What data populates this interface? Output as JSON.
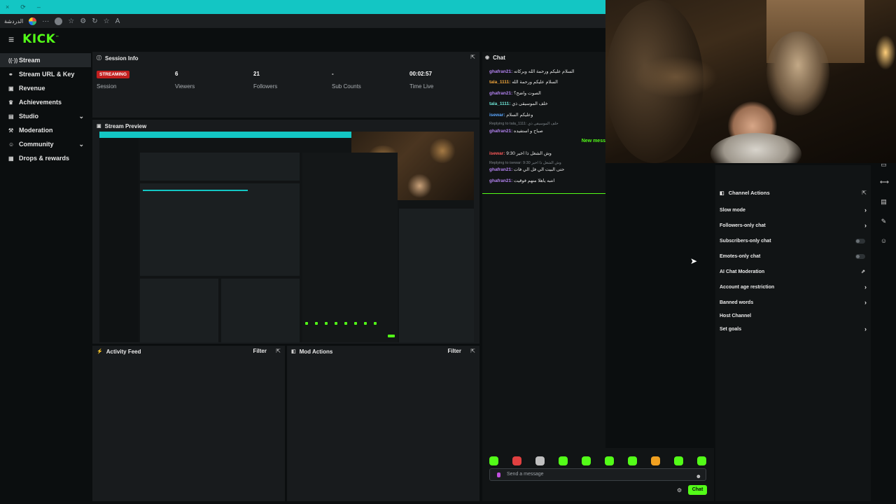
{
  "browser": {
    "tab_label": "الدردشة",
    "controls": [
      "×",
      "⟳",
      "–"
    ]
  },
  "header": {
    "logo": "KICK",
    "logo_tm": "™"
  },
  "sidebar": {
    "items": [
      {
        "label": "Stream",
        "icon": "broadcast-icon"
      },
      {
        "label": "Stream URL & Key",
        "icon": "link-icon"
      },
      {
        "label": "Revenue",
        "icon": "wallet-icon"
      },
      {
        "label": "Achievements",
        "icon": "trophy-icon"
      },
      {
        "label": "Studio",
        "icon": "studio-icon"
      },
      {
        "label": "Moderation",
        "icon": "hammer-icon"
      },
      {
        "label": "Community",
        "icon": "people-icon"
      },
      {
        "label": "Drops & rewards",
        "icon": "gift-icon"
      }
    ]
  },
  "session": {
    "title": "Session Info",
    "status": "STREAMING",
    "status_label": "Session",
    "viewers": "6",
    "viewers_label": "Viewers",
    "followers": "21",
    "followers_label": "Followers",
    "subs": "-",
    "subs_label": "Sub Counts",
    "time": "00:02:57",
    "time_label": "Time Live"
  },
  "preview": {
    "title": "Stream Preview"
  },
  "activity": {
    "title": "Activity Feed",
    "filter": "Filter"
  },
  "mod_actions": {
    "title": "Mod Actions",
    "filter": "Filter"
  },
  "chat": {
    "title": "Chat",
    "new_messages": "New mess",
    "messages": [
      {
        "user": "ghafran21:",
        "text": "السلام عليكم ورحمة الله وبركاته",
        "color": "#b483f2"
      },
      {
        "user": "tala_1111:",
        "text": "السلام عليكم ورحمة الله",
        "color": "#f2a63b"
      },
      {
        "user": "ghafran21:",
        "text": "الصوت واضح؟",
        "color": "#b483f2"
      },
      {
        "user": "tala_1111:",
        "text": "خلف الموسيقى ذي",
        "color": "#6ee7d8"
      },
      {
        "user": "isewar:",
        "text": "وعليكم السلام",
        "color": "#5aa7ff"
      },
      {
        "user": "ghafran21:",
        "text": "صباح و استفيده",
        "color": "#b483f2"
      },
      {
        "user": "isewar:",
        "text": "وش الشغل ذا اخير 9:30",
        "color": "#ff5a5a"
      },
      {
        "user": "ghafran21:",
        "text": "حتى البيت الي فل الي فات",
        "color": "#b483f2"
      },
      {
        "user": "ghafran21:",
        "text": "انتبه ياهلا منهم فوقيت",
        "color": "#b483f2"
      }
    ],
    "replies": [
      "Replying to tala_1111: خلف الموسيقى ذي",
      "Replying to isewar: وش الشغل ذا اخير 9:30"
    ],
    "input_placeholder": "Send a message",
    "send_label": "Chat"
  },
  "channel_actions": {
    "title": "Channel Actions",
    "items": [
      {
        "label": "Slow mode",
        "control": "arrow"
      },
      {
        "label": "Followers-only chat",
        "control": "arrow"
      },
      {
        "label": "Subscribers-only chat",
        "control": "toggle"
      },
      {
        "label": "Emotes-only chat",
        "control": "toggle"
      },
      {
        "label": "AI Chat Moderation",
        "control": "external"
      },
      {
        "label": "Account age restriction",
        "control": "arrow"
      },
      {
        "label": "Banned words",
        "control": "arrow"
      },
      {
        "label": "Host Channel",
        "control": "none"
      },
      {
        "label": "Set goals",
        "control": "arrow"
      }
    ]
  },
  "colors": {
    "brand": "#53fc18",
    "live": "#c21f1f",
    "teal": "#13c6c4"
  }
}
